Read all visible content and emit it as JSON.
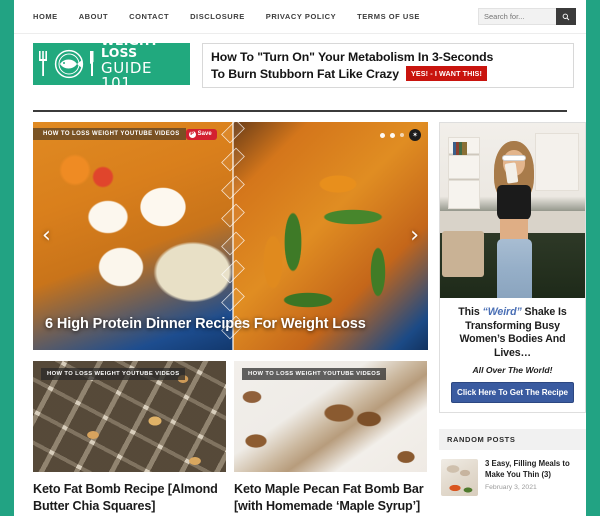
{
  "site": {
    "logo_line1": "WEIGHT LOSS",
    "logo_line2": "GUIDE 101"
  },
  "nav": {
    "items": [
      {
        "label": "HOME"
      },
      {
        "label": "ABOUT"
      },
      {
        "label": "CONTACT"
      },
      {
        "label": "DISCLOSURE"
      },
      {
        "label": "PRIVACY POLICY"
      },
      {
        "label": "TERMS OF USE"
      }
    ]
  },
  "search": {
    "placeholder": "Search for...",
    "icon": "search-icon"
  },
  "banner": {
    "line1": "How To \"Turn On\" Your Metabolism In 3-Seconds",
    "line2": "To Burn Stubborn Fat Like Crazy",
    "cta": "YES! - I WANT THIS!",
    "cta_color": "#c9140e"
  },
  "slider": {
    "save_badge": "Save",
    "save_icon": "pinterest-icon",
    "category": "HOW TO LOSS WEIGHT YOUTUBE VIDEOS",
    "title": "6 High Protein Dinner Recipes For Weight Loss",
    "prev_arrow": "‹",
    "next_arrow": "›",
    "pause_icon": "✶",
    "dots": 3,
    "active_dot": 0
  },
  "cards": [
    {
      "category": "HOW TO LOSS WEIGHT YOUTUBE VIDEOS",
      "title": "Keto Fat Bomb Recipe [Almond Butter Chia Squares]"
    },
    {
      "category": "HOW TO LOSS WEIGHT YOUTUBE VIDEOS",
      "title": "Keto Maple Pecan Fat Bomb Bar [with Homemade ‘Maple Syrup’]"
    }
  ],
  "sidebar": {
    "ad": {
      "headline_1": "This ",
      "headline_em": "“Weird”",
      "headline_2": " Shake Is Transforming Busy Women’s Bodies And Lives…",
      "subline": "All Over The World!",
      "button": "Click Here To Get The Recipe",
      "button_color": "#3a5ba0"
    },
    "widget": {
      "title": "RANDOM POSTS",
      "posts": [
        {
          "title": "3 Easy, Filling Meals to Make You Thin (3)",
          "date": "February 3, 2021"
        }
      ]
    }
  },
  "theme": {
    "frame_color": "#22a383",
    "logo_bg": "#21a97e",
    "divider": "#3b3b3b"
  }
}
